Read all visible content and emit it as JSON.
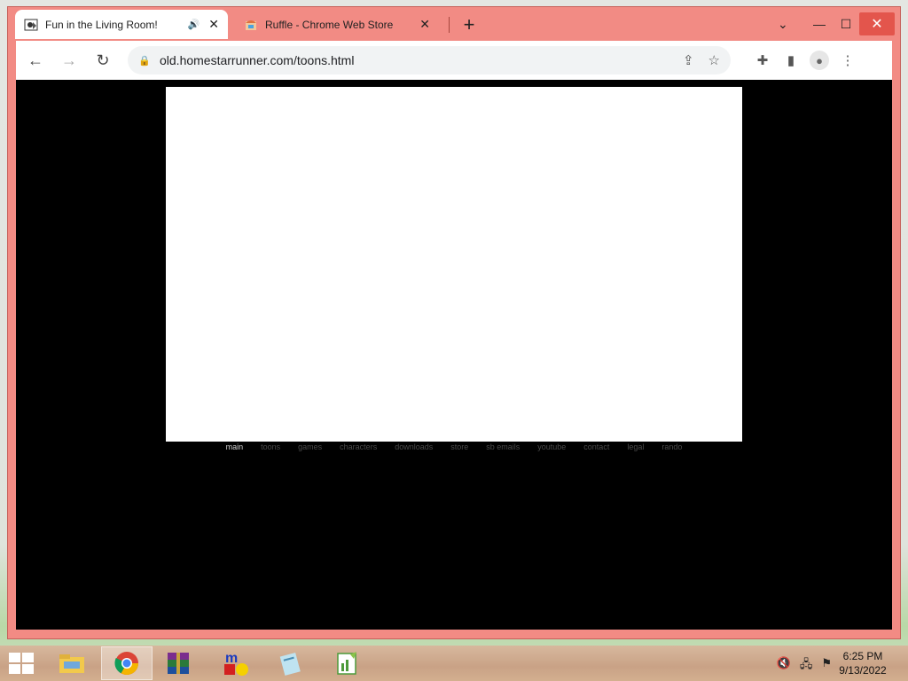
{
  "browser": {
    "tabs": [
      {
        "title": "Fun in the Living Room!",
        "favicon": "homestar-icon",
        "audio": true,
        "active": true
      },
      {
        "title": "Ruffle - Chrome Web Store",
        "favicon": "ruffle-icon",
        "audio": false,
        "active": false
      }
    ],
    "url": "old.homestarrunner.com/toons.html"
  },
  "site_nav": [
    "main",
    "toons",
    "games",
    "characters",
    "downloads",
    "store",
    "sb emails",
    "youtube",
    "contact",
    "legal",
    "rando"
  ],
  "taskbar": {
    "time": "6:25 PM",
    "date": "9/13/2022",
    "apps": [
      "file-explorer",
      "chrome",
      "winrar",
      "mircosoft-app",
      "notepad",
      "winamp-ish"
    ]
  },
  "colors": {
    "window_frame": "#f28b84",
    "close_button": "#e3554c",
    "viewport_bg": "#000000",
    "flash_bg": "#ffffff"
  }
}
